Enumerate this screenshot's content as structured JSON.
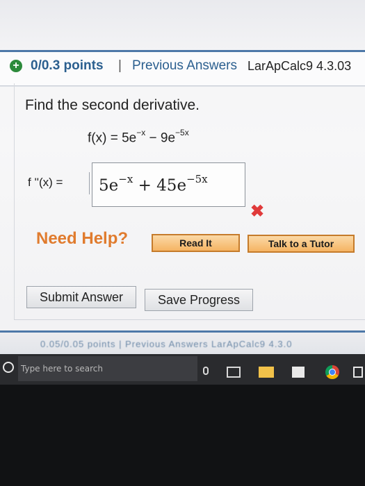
{
  "header": {
    "points": "0/0.3 points",
    "separator": "|",
    "previous_answers": "Previous Answers",
    "course_ref": "LarApCalc9 4.3.03"
  },
  "question": {
    "prompt": "Find the second derivative.",
    "function_lhs": "f(x) = 5e",
    "function_exp1": "−x",
    "function_mid": " − 9e",
    "function_exp2": "−5x",
    "answer_label": "f ''(x) =",
    "answer_part1": "5e",
    "answer_exp1": "−x",
    "answer_part2": " + 45e",
    "answer_exp2": "−5x"
  },
  "status": {
    "result_icon": "wrong-icon",
    "result_color": "#e03a3a"
  },
  "help": {
    "label": "Need Help?",
    "read_it": "Read It",
    "talk_to_tutor": "Talk to a Tutor"
  },
  "actions": {
    "submit": "Submit Answer",
    "save": "Save Progress"
  },
  "next_question": {
    "text": "0.05/0.05 points  |  Previous Answers  LarApCalc9 4.3.0"
  },
  "taskbar": {
    "search_placeholder": "Type here to search"
  },
  "colors": {
    "link": "#2b5f8f",
    "need_help": "#e07b2e",
    "header_border": "#4d78a8"
  }
}
